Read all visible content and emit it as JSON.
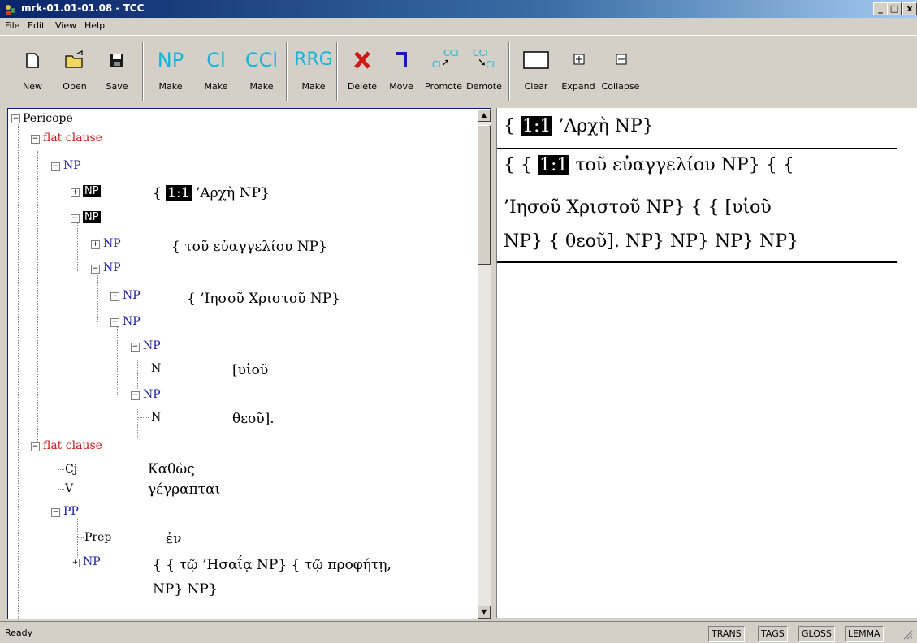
{
  "window": {
    "title": "mrk-01.01-01.08 - TCC",
    "min": "_",
    "max": "□",
    "close": "x"
  },
  "menu": [
    "File",
    "Edit",
    "View",
    "Help"
  ],
  "toolbar": {
    "new": "New",
    "open": "Open",
    "save": "Save",
    "np_icon": "NP",
    "np": "Make",
    "cl_icon": "Cl",
    "cl": "Make",
    "ccl_icon": "CCl",
    "ccl": "Make",
    "rrg_icon": "RRG",
    "rrg": "Make",
    "delete": "Delete",
    "move": "Move",
    "promote": "Promote",
    "demote": "Demote",
    "promote_icon_top": "CCl",
    "promote_icon_bot": "Cl",
    "demote_icon_top": "CCl",
    "demote_icon_bot": "Cl",
    "clear": "Clear",
    "expand": "Expand",
    "collapse": "Collapse"
  },
  "tree": {
    "root": "Pericope",
    "clause1": "flat clause",
    "np_a": "NP",
    "np_b": "NP",
    "np_b_ref": "1:1",
    "np_b_text": "{ ",
    "np_b_greek": "’Αρχὴ NP}",
    "np_c": "NP",
    "np_d": "NP",
    "np_d_text": "{ τοῦ εὐαγγελίου NP}",
    "np_e": "NP",
    "np_f": "NP",
    "np_f_text": "{ ’Ιησοῦ Χριστοῦ NP}",
    "np_g": "NP",
    "np_h": "NP",
    "n_h": "N",
    "n_h_text": "[υἱοῦ",
    "np_i": "NP",
    "n_i": "N",
    "n_i_text": "θεοῦ].",
    "clause2": "flat clause",
    "cj": "Cj",
    "cj_text": "Καθὼς",
    "v": "V",
    "v_text": "γέγραπται",
    "pp": "PP",
    "prep": "Prep",
    "prep_text": "ἐν",
    "np_j": "NP",
    "np_j_text1": "{ { τῷ ’Ησαΐᾳ NP} { τῷ προφήτῃ,",
    "np_j_text2": "NP} NP}"
  },
  "text": {
    "line1_pre": "{ ",
    "line1_ref": "1:1",
    "line1_post": " ’Αρχὴ NP}",
    "line2_pre": "{ { ",
    "line2_ref": "1:1",
    "line2_post": " τοῦ εὐαγγελίου NP} { {",
    "line3": "’Ιησοῦ Χριστοῦ NP} { { [υἱοῦ",
    "line4": "NP} { θεοῦ]. NP} NP} NP} NP}"
  },
  "status": {
    "ready": "Ready",
    "panels": [
      "TRANS",
      "TAGS",
      "GLOSS",
      "LEMMA"
    ]
  }
}
